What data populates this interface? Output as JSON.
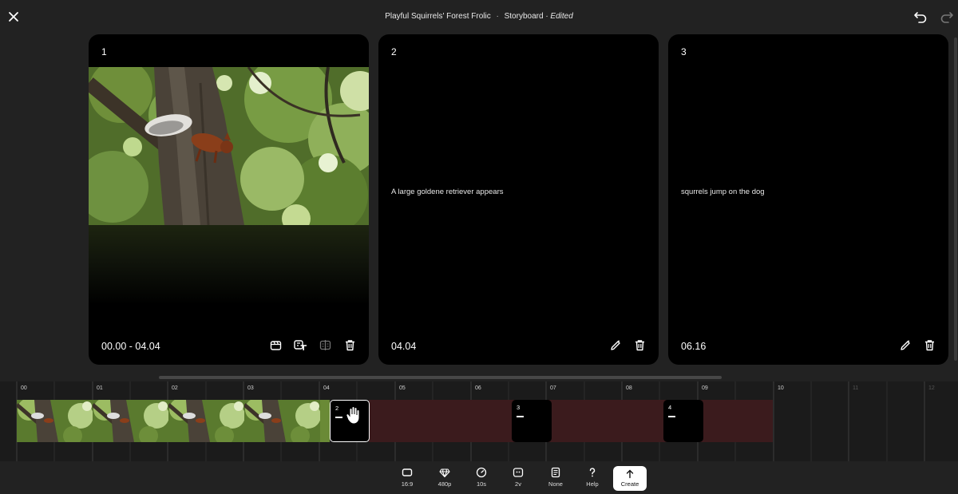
{
  "header": {
    "project_title": "Playful Squirrels' Forest Frolic",
    "separator": "·",
    "section": "Storyboard",
    "status": "· Edited"
  },
  "cards": [
    {
      "number": "1",
      "time": "00.00 - 04.04",
      "prompt": ""
    },
    {
      "number": "2",
      "time": "04.04",
      "prompt": "A large goldene retriever appears"
    },
    {
      "number": "3",
      "time": "06.16",
      "prompt": "squrrels jump on the dog"
    }
  ],
  "timeline": {
    "ticks": [
      "00",
      "01",
      "02",
      "03",
      "04",
      "05",
      "06",
      "07",
      "08",
      "09",
      "10",
      "11",
      "12"
    ],
    "segments": [
      {
        "number": "2",
        "selected": true
      },
      {
        "number": "3",
        "selected": false
      },
      {
        "number": "4",
        "selected": false
      }
    ]
  },
  "toolbar": {
    "aspect": "16:9",
    "resolution": "480p",
    "duration": "10s",
    "variations": "2v",
    "preset": "None",
    "help": "Help",
    "create": "Create"
  },
  "colors": {
    "background": "#222222",
    "card": "#000000",
    "timeline_empty": "#3b1b1d",
    "create_button": "#ffffff"
  }
}
